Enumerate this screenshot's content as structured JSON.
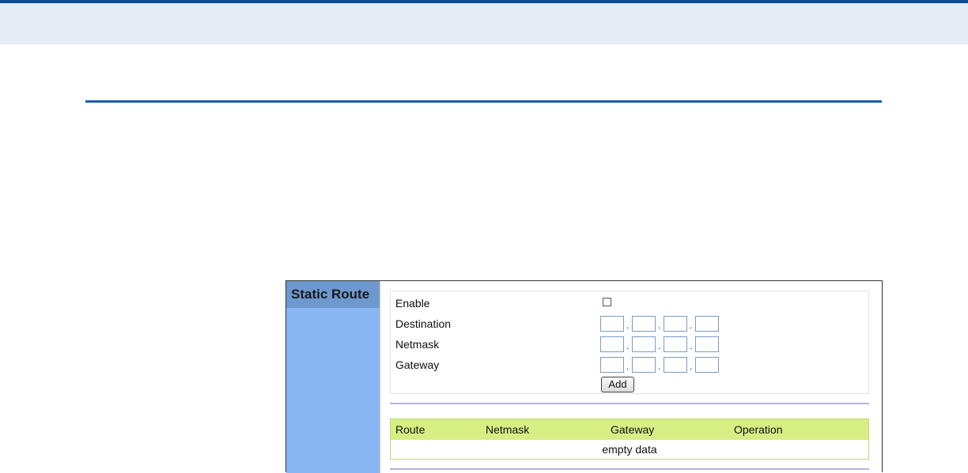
{
  "panel": {
    "title": "Static Route"
  },
  "form": {
    "enable_label": "Enable",
    "enable_checked": false,
    "destination_label": "Destination",
    "netmask_label": "Netmask",
    "gateway_label": "Gateway",
    "destination_octets": [
      "",
      "",
      "",
      ""
    ],
    "netmask_octets": [
      "",
      "",
      "",
      ""
    ],
    "gateway_octets": [
      "",
      "",
      "",
      ""
    ],
    "octet_separator": ".",
    "add_label": "Add"
  },
  "table": {
    "headers": [
      "Route",
      "Netmask",
      "Gateway",
      "Operation"
    ],
    "empty_text": "empty data",
    "rows": []
  },
  "colors": {
    "top_band": "#e5ecf5",
    "top_border": "#0b4a94",
    "page_rule": "#1b5ea8",
    "sidebar": "#87b6f3",
    "sidebar_title": "#6e99cf",
    "table_header": "#d6ee84",
    "table_border": "#b6de6c",
    "divider": "#b6b3dc"
  }
}
